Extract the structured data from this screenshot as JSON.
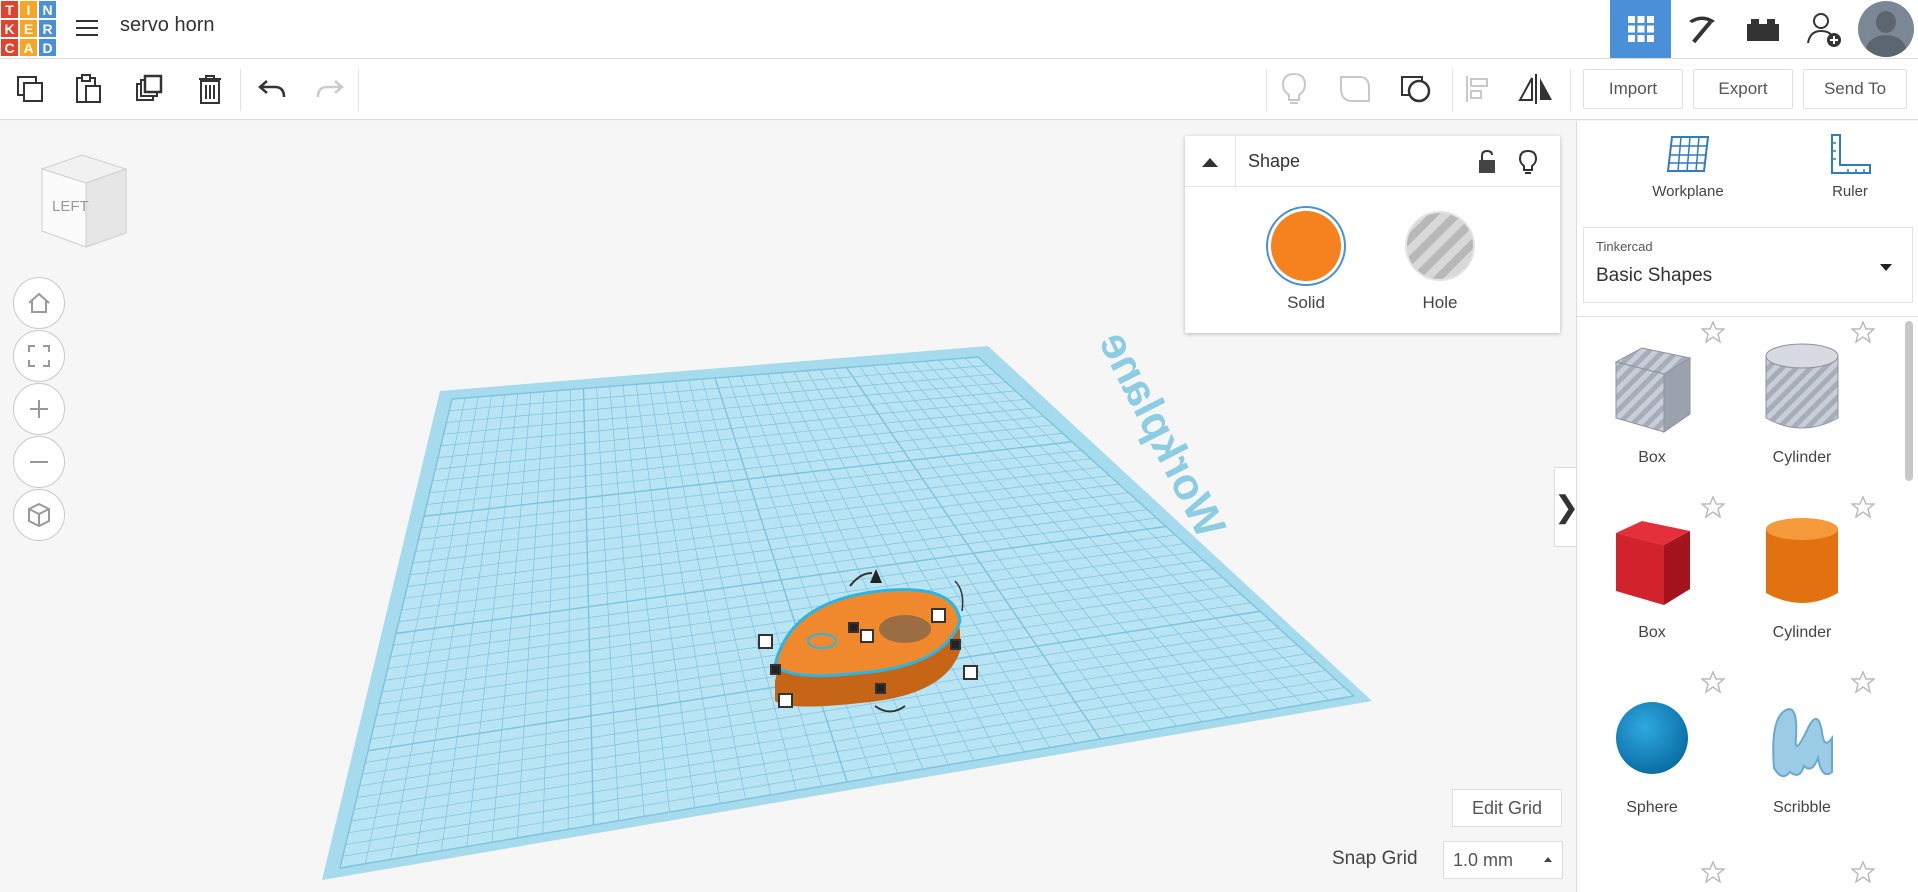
{
  "app": {
    "logo_letters": [
      "T",
      "I",
      "N",
      "K",
      "E",
      "R",
      "C",
      "A",
      "D"
    ],
    "logo_colors": [
      "#e2412c",
      "#f6a623",
      "#4a90d9",
      "#e2412c",
      "#f6a623",
      "#4a90d9",
      "#e2412c",
      "#f6a623",
      "#4a90d9"
    ],
    "document_title": "servo horn"
  },
  "top_nav": {
    "items": [
      {
        "name": "3d-design-view-icon",
        "active": true
      },
      {
        "name": "pickaxe-icon",
        "active": false
      },
      {
        "name": "bricks-icon",
        "active": false
      },
      {
        "name": "add-user-icon",
        "active": false
      }
    ]
  },
  "toolbar": {
    "import_label": "Import",
    "export_label": "Export",
    "send_to_label": "Send To"
  },
  "viewport": {
    "viewcube_label": "LEFT",
    "workplane_text": "Workplane",
    "edit_grid_label": "Edit Grid",
    "snap_grid_label": "Snap Grid",
    "snap_grid_value": "1.0 mm"
  },
  "inspector": {
    "title": "Shape",
    "solid_label": "Solid",
    "hole_label": "Hole",
    "solid_color": "#f5821f"
  },
  "right_panel": {
    "workplane_label": "Workplane",
    "ruler_label": "Ruler",
    "library_group": "Tinkercad",
    "library_name": "Basic Shapes",
    "shapes": [
      {
        "label": "Box",
        "icon": "box-hole-icon"
      },
      {
        "label": "Cylinder",
        "icon": "cylinder-hole-icon"
      },
      {
        "label": "Box",
        "icon": "box-red-icon"
      },
      {
        "label": "Cylinder",
        "icon": "cylinder-orange-icon"
      },
      {
        "label": "Sphere",
        "icon": "sphere-blue-icon"
      },
      {
        "label": "Scribble",
        "icon": "scribble-icon"
      }
    ]
  },
  "colors": {
    "accent": "#4a90d9",
    "workplane": "#a6dbee",
    "shape_orange": "#f5821f"
  }
}
